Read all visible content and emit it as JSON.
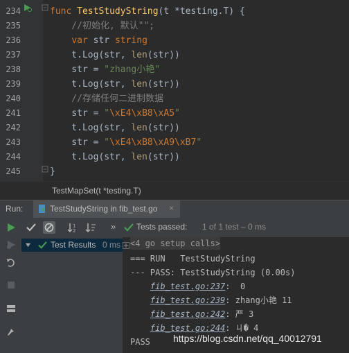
{
  "editor": {
    "line_numbers": [
      "234",
      "235",
      "236",
      "237",
      "238",
      "239",
      "240",
      "241",
      "242",
      "243",
      "244",
      "245"
    ],
    "lines": [
      [
        {
          "t": "func ",
          "c": "kw"
        },
        {
          "t": "TestStudyString",
          "c": "fn"
        },
        {
          "t": "(t *testing.T) {",
          "c": ""
        }
      ],
      [
        {
          "t": "    //初始化, 默认\"\";",
          "c": "cm"
        }
      ],
      [
        {
          "t": "    ",
          "c": ""
        },
        {
          "t": "var ",
          "c": "kw"
        },
        {
          "t": "str ",
          "c": ""
        },
        {
          "t": "string",
          "c": "tp"
        }
      ],
      [
        {
          "t": "    t.Log(str, ",
          "c": ""
        },
        {
          "t": "len",
          "c": "bf"
        },
        {
          "t": "(str))",
          "c": ""
        }
      ],
      [
        {
          "t": "    str = ",
          "c": ""
        },
        {
          "t": "\"zhang小艳\"",
          "c": "st"
        }
      ],
      [
        {
          "t": "    t.Log(str, ",
          "c": ""
        },
        {
          "t": "len",
          "c": "bf"
        },
        {
          "t": "(str))",
          "c": ""
        }
      ],
      [
        {
          "t": "    //存储任何二进制数据",
          "c": "cm"
        }
      ],
      [
        {
          "t": "    str = ",
          "c": ""
        },
        {
          "t": "\"",
          "c": "st"
        },
        {
          "t": "\\xE4\\xB8\\xA5",
          "c": "esc"
        },
        {
          "t": "\"",
          "c": "st"
        }
      ],
      [
        {
          "t": "    t.Log(str, ",
          "c": ""
        },
        {
          "t": "len",
          "c": "bf"
        },
        {
          "t": "(str))",
          "c": ""
        }
      ],
      [
        {
          "t": "    str = ",
          "c": ""
        },
        {
          "t": "\"",
          "c": "st"
        },
        {
          "t": "\\xE4\\xB8\\xA9\\xB7",
          "c": "esc"
        },
        {
          "t": "\"",
          "c": "st"
        }
      ],
      [
        {
          "t": "    t.Log(str, ",
          "c": ""
        },
        {
          "t": "len",
          "c": "bf"
        },
        {
          "t": "(str))",
          "c": ""
        }
      ],
      [
        {
          "t": "}",
          "c": ""
        }
      ]
    ],
    "breadcrumb": "TestMapSet(t *testing.T)"
  },
  "run_panel": {
    "label": "Run:",
    "tab_title": "TestStudyString in fib_test.go",
    "tab_close": "×",
    "status_passed": "Tests passed:",
    "status_detail": "1 of 1 test – 0 ms",
    "tree_root": "Test Results",
    "tree_time": "0 ms",
    "console_header": "<4 go setup calls>",
    "console_lines": [
      {
        "text": "=== RUN   TestStudyString"
      },
      {
        "text": "--- PASS: TestStudyString (0.00s)"
      },
      {
        "link": "fib_test.go:237",
        "rest": ":  0"
      },
      {
        "link": "fib_test.go:239",
        "rest": ": zhang小艳 11"
      },
      {
        "link": "fib_test.go:242",
        "rest": ": 严 3"
      },
      {
        "link": "fib_test.go:244",
        "rest": ": ㄐ� 4"
      },
      {
        "text": "PASS"
      }
    ]
  },
  "colors": {
    "accent_green": "#499c54",
    "bg": "#2b2b2b",
    "panel": "#3c3f41"
  },
  "watermark": "https://blog.csdn.net/qq_40012791"
}
